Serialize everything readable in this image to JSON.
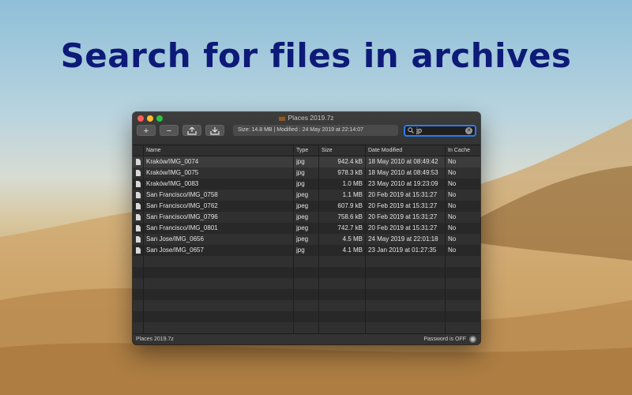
{
  "headline": "Search for files in archives",
  "window": {
    "title": "Places 2019.7z",
    "toolbar": {
      "add_label": "+",
      "remove_label": "−",
      "info": "Size: 14.8 MB  |  Modified : 24 May 2019 at 22:14:07"
    },
    "search": {
      "value": "jp"
    },
    "columns": [
      "Name",
      "Type",
      "Size",
      "Date Modified",
      "In Cache"
    ],
    "rows": [
      {
        "name": "Kraków/IMG_0074",
        "type": "jpg",
        "size": "942.4 kB",
        "date": "18 May 2010 at 08:49:42",
        "cache": "No"
      },
      {
        "name": "Kraków/IMG_0075",
        "type": "jpg",
        "size": "978.3 kB",
        "date": "18 May 2010 at 08:49:53",
        "cache": "No"
      },
      {
        "name": "Kraków/IMG_0083",
        "type": "jpg",
        "size": "1.0 MB",
        "date": "23 May 2010 at 19:23:09",
        "cache": "No"
      },
      {
        "name": "San Francisco/IMG_0758",
        "type": "jpeg",
        "size": "1.1 MB",
        "date": "20 Feb 2019 at 15:31:27",
        "cache": "No"
      },
      {
        "name": "San Francisco/IMG_0762",
        "type": "jpeg",
        "size": "607.9 kB",
        "date": "20 Feb 2019 at 15:31:27",
        "cache": "No"
      },
      {
        "name": "San Francisco/IMG_0796",
        "type": "jpeg",
        "size": "758.6 kB",
        "date": "20 Feb 2019 at 15:31:27",
        "cache": "No"
      },
      {
        "name": "San Francisco/IMG_0801",
        "type": "jpeg",
        "size": "742.7 kB",
        "date": "20 Feb 2019 at 15:31:27",
        "cache": "No"
      },
      {
        "name": "San Jose/IMG_0656",
        "type": "jpeg",
        "size": "4.5 MB",
        "date": "24 May 2019 at 22:01:18",
        "cache": "No"
      },
      {
        "name": "San Jose/IMG_0657",
        "type": "jpg",
        "size": "4.1 MB",
        "date": "23 Jan 2019 at 01:27:35",
        "cache": "No"
      }
    ],
    "status": {
      "left": "Places 2019.7z",
      "right": "Password is OFF"
    }
  }
}
